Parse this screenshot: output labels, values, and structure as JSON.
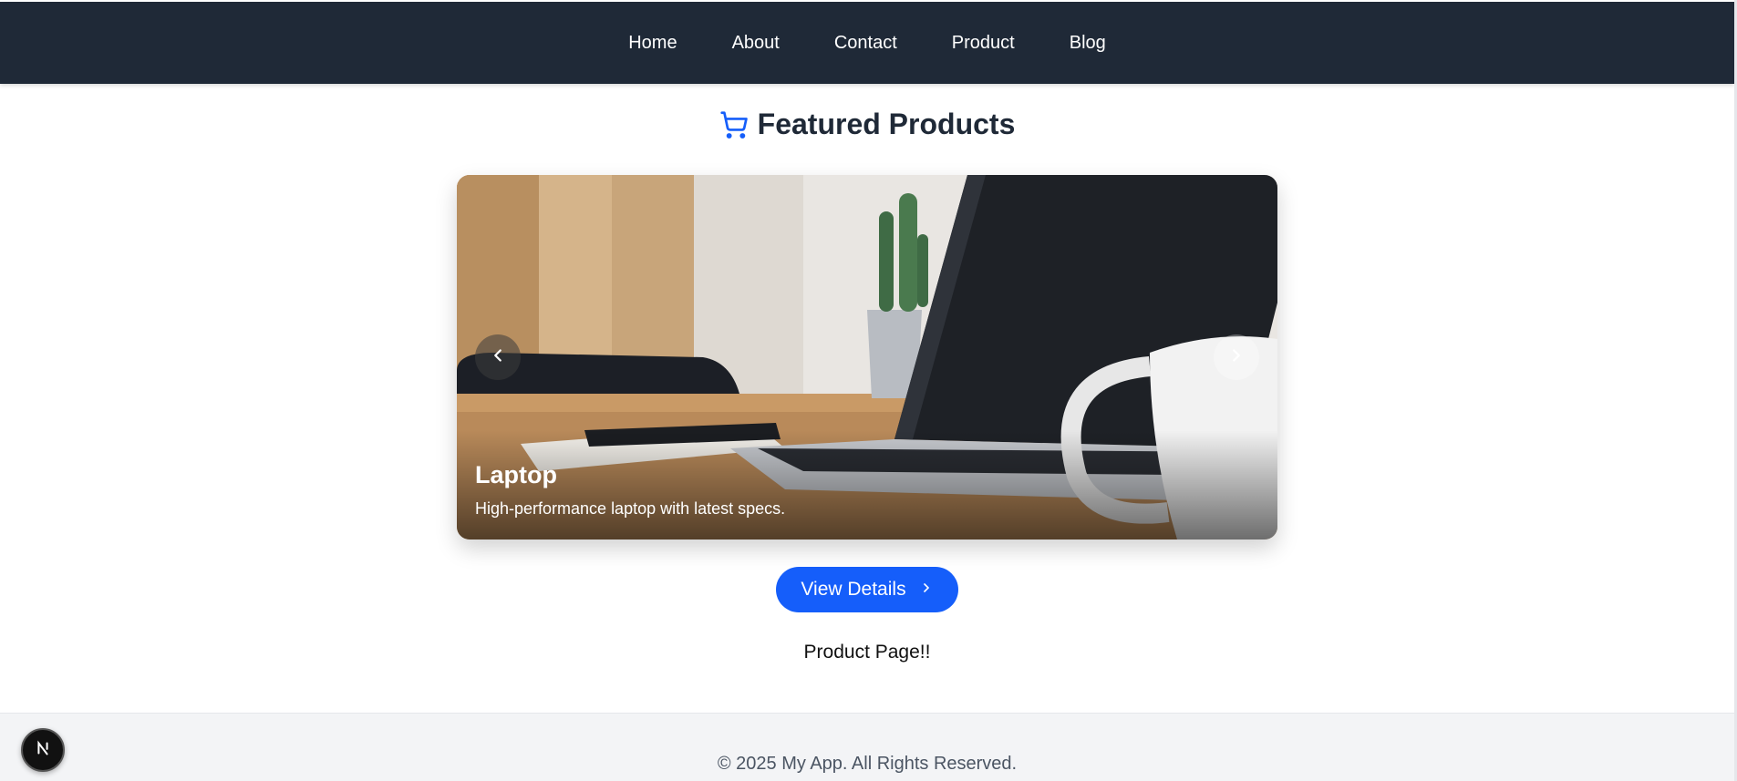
{
  "nav": {
    "items": [
      {
        "label": "Home"
      },
      {
        "label": "About"
      },
      {
        "label": "Contact"
      },
      {
        "label": "Product"
      },
      {
        "label": "Blog"
      }
    ]
  },
  "heading": {
    "title": "Featured Products",
    "icon": "shopping-cart-icon"
  },
  "carousel": {
    "slide": {
      "title": "Laptop",
      "description": "High-performance laptop with latest specs."
    },
    "prev_icon": "chevron-left-icon",
    "next_icon": "chevron-right-icon"
  },
  "actions": {
    "view_details_label": "View Details",
    "view_details_icon": "chevron-right-icon"
  },
  "main": {
    "note": "Product Page!!"
  },
  "footer": {
    "text": "© 2025 My App. All Rights Reserved."
  },
  "dev_badge": {
    "icon": "nextjs-logo-icon"
  },
  "colors": {
    "navbar_bg": "#1f2937",
    "accent": "#155efa",
    "footer_bg": "#f3f4f6"
  }
}
